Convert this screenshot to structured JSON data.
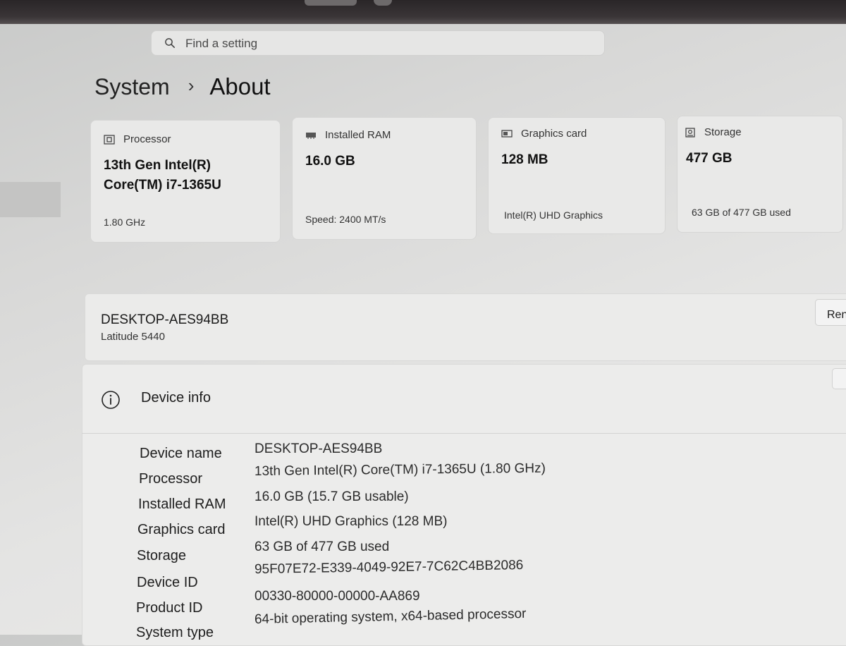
{
  "search": {
    "placeholder": "Find a setting"
  },
  "breadcrumb": {
    "parent": "System",
    "separator": "›",
    "current": "About"
  },
  "cards": [
    {
      "title": "Processor",
      "icon": "processor-icon",
      "value": "13th Gen Intel(R) Core(TM) i7-1365U",
      "footer": "1.80 GHz"
    },
    {
      "title": "Installed RAM",
      "icon": "ram-icon",
      "value": "16.0 GB",
      "footer": "Speed: 2400 MT/s"
    },
    {
      "title": "Graphics card",
      "icon": "graphics-card-icon",
      "value": "128 MB",
      "footer": "Intel(R) UHD Graphics"
    },
    {
      "title": "Storage",
      "icon": "storage-icon",
      "value": "477 GB",
      "footer": "63 GB of 477 GB used"
    }
  ],
  "device": {
    "name": "DESKTOP-AES94BB",
    "model": "Latitude 5440",
    "rename_label": "Ren"
  },
  "device_info": {
    "title": "Device info",
    "rows": [
      {
        "label": "Device name",
        "value": "DESKTOP-AES94BB"
      },
      {
        "label": "Processor",
        "value": "13th Gen Intel(R) Core(TM) i7-1365U (1.80 GHz)"
      },
      {
        "label": "Installed RAM",
        "value": "16.0 GB (15.7 GB usable)"
      },
      {
        "label": "Graphics card",
        "value": "Intel(R) UHD Graphics (128 MB)"
      },
      {
        "label": "Storage",
        "value": "63 GB of 477 GB used"
      },
      {
        "label": "Device ID",
        "value": "95F07E72-E339-4049-92E7-7C62C4BB2086"
      },
      {
        "label": "Product ID",
        "value": "00330-80000-00000-AA869"
      },
      {
        "label": "System type",
        "value": "64-bit operating system, x64-based processor"
      }
    ]
  }
}
